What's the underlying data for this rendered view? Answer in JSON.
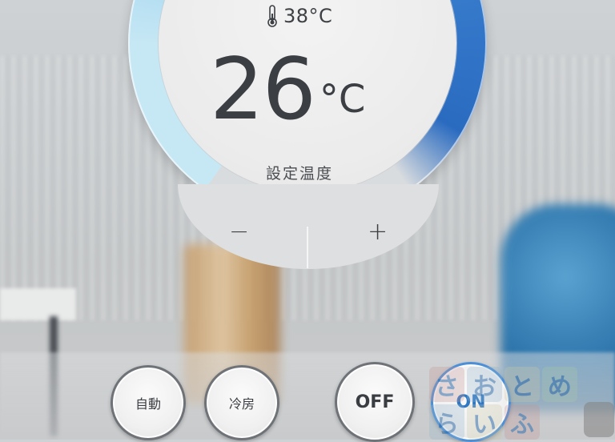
{
  "ambient": {
    "icon": "thermometer-icon",
    "text": "38°C"
  },
  "set_temperature": {
    "value": "26",
    "unit": "°C",
    "label": "設定温度"
  },
  "controls": {
    "minus_label": "−",
    "plus_label": "+"
  },
  "modes": {
    "auto_label": "自動",
    "cool_label": "冷房"
  },
  "power": {
    "off_label": "OFF",
    "on_label": "ON"
  },
  "watermark": {
    "chars": [
      "さ",
      "お",
      "と",
      "め",
      "ら",
      "い",
      "ふ"
    ]
  },
  "colors": {
    "dial_cool": "#94d0ef",
    "dial_warm": "#2a6bc0",
    "text_dark": "#3b3e42",
    "on_accent": "#2f78c4"
  }
}
